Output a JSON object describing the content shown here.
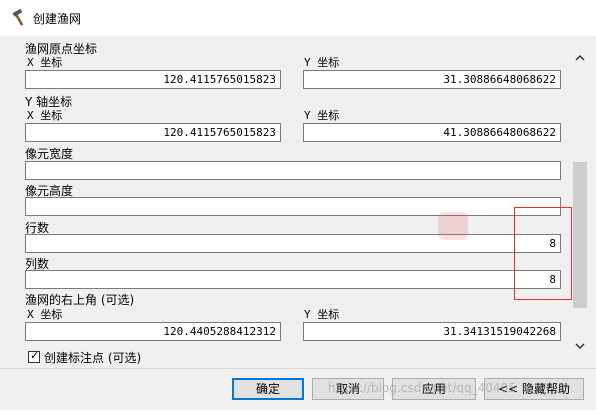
{
  "window": {
    "title": "创建渔网"
  },
  "origin": {
    "label": "渔网原点坐标",
    "x_label": "X 坐标",
    "x_value": "120.4115765015823",
    "y_label": "Y 坐标",
    "y_value": "31.30886648068622"
  },
  "yaxis": {
    "label": "Y 轴坐标",
    "x_label": "X 坐标",
    "x_value": "120.4115765015823",
    "y_label": "Y 坐标",
    "y_value": "41.30886648068622"
  },
  "cell_width": {
    "label": "像元宽度",
    "value": ""
  },
  "cell_height": {
    "label": "像元高度",
    "value": ""
  },
  "rows": {
    "label": "行数",
    "value": "8"
  },
  "cols": {
    "label": "列数",
    "value": "8"
  },
  "corner": {
    "label": "渔网的右上角 (可选)",
    "x_label": "X 坐标",
    "x_value": "120.4405288412312",
    "y_label": "Y 坐标",
    "y_value": "31.34131519042268"
  },
  "labels_option": {
    "label": "创建标注点 (可选)",
    "checked": true
  },
  "buttons": {
    "ok": "确定",
    "cancel": "取消",
    "apply": "应用",
    "help": "<< 隐藏帮助"
  },
  "watermark": "https://blog.csdn.net/qq_40405"
}
